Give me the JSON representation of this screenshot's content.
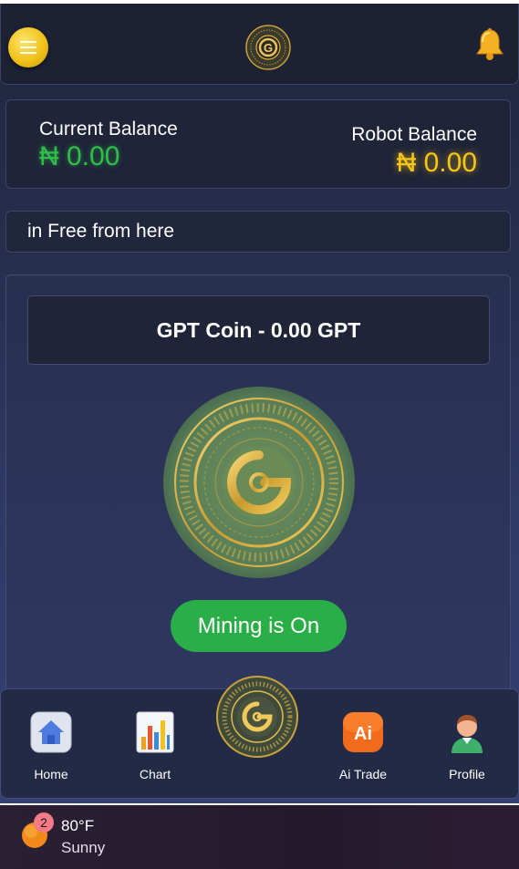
{
  "header": {
    "menu_icon": "hamburger-menu-icon",
    "logo_icon": "gpt-coin-logo-icon",
    "bell_icon": "notification-bell-icon"
  },
  "balances": {
    "current_label": "Current Balance",
    "current_value": "₦ 0.00",
    "robot_label": "Robot Balance",
    "robot_value": "₦ 0.00"
  },
  "marquee": {
    "text": "in Free from here"
  },
  "mining": {
    "coin_balance": "GPT Coin - 0.00 GPT",
    "button_label": "Mining is On"
  },
  "nav": {
    "items": [
      {
        "label": "Home",
        "icon": "home-icon"
      },
      {
        "label": "Chart",
        "icon": "bar-chart-icon"
      },
      {
        "label": "",
        "icon": "gpt-coin-icon"
      },
      {
        "label": "Ai Trade",
        "icon": "ai-icon"
      },
      {
        "label": "Profile",
        "icon": "user-avatar-icon"
      }
    ]
  },
  "taskbar": {
    "badge_count": "2",
    "temperature": "80°F",
    "condition": "Sunny"
  },
  "colors": {
    "green": "#2fbe4a",
    "gold": "#f7c518",
    "button_green": "#2aae47"
  }
}
